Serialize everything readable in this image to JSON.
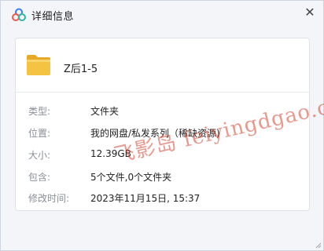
{
  "window": {
    "title": "详细信息",
    "close_glyph": "✕"
  },
  "file": {
    "icon": "folder-icon",
    "name": "Z后1-5"
  },
  "details": [
    {
      "label": "类型:",
      "value": "文件夹"
    },
    {
      "label": "位置:",
      "value": "我的网盘/私发系列（稀缺资源)"
    },
    {
      "label": "大小:",
      "value": "12.39GB"
    },
    {
      "label": "包含:",
      "value": "5个文件,0个文件夹"
    },
    {
      "label": "修改时间:",
      "value": "2023年11月15日, 15:37"
    }
  ],
  "watermark": {
    "text": "飞影岛 feiyingdgao.com"
  },
  "colors": {
    "accent_folder": "#f5c342",
    "watermark": "#d24632",
    "label_gray": "#8a8f98"
  }
}
